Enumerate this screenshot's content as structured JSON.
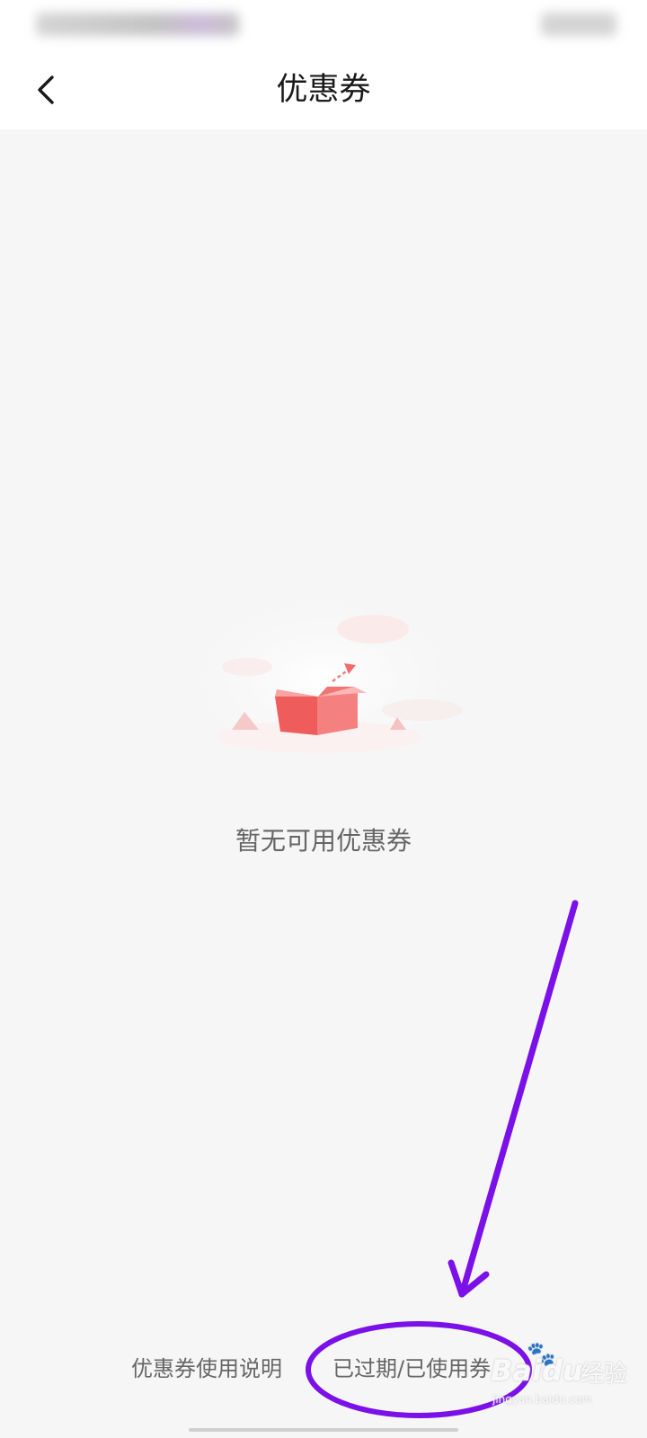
{
  "header": {
    "title": "优惠券",
    "back_icon": "chevron-left-icon"
  },
  "empty_state": {
    "illustration": "open-gift-box",
    "message": "暂无可用优惠券"
  },
  "footer": {
    "instructions_label": "优惠券使用说明",
    "expired_used_label": "已过期/已使用券",
    "expired_used_arrow": "›"
  },
  "annotation": {
    "color": "#7b10e8",
    "shapes": [
      "arrow",
      "ellipse"
    ]
  },
  "watermark": {
    "brand": "Baidu",
    "service": "经验",
    "url": "jingyan.baidu.com"
  },
  "colors": {
    "background": "#f6f6f6",
    "header_background": "#ffffff",
    "box_red": "#f26a6a"
  }
}
